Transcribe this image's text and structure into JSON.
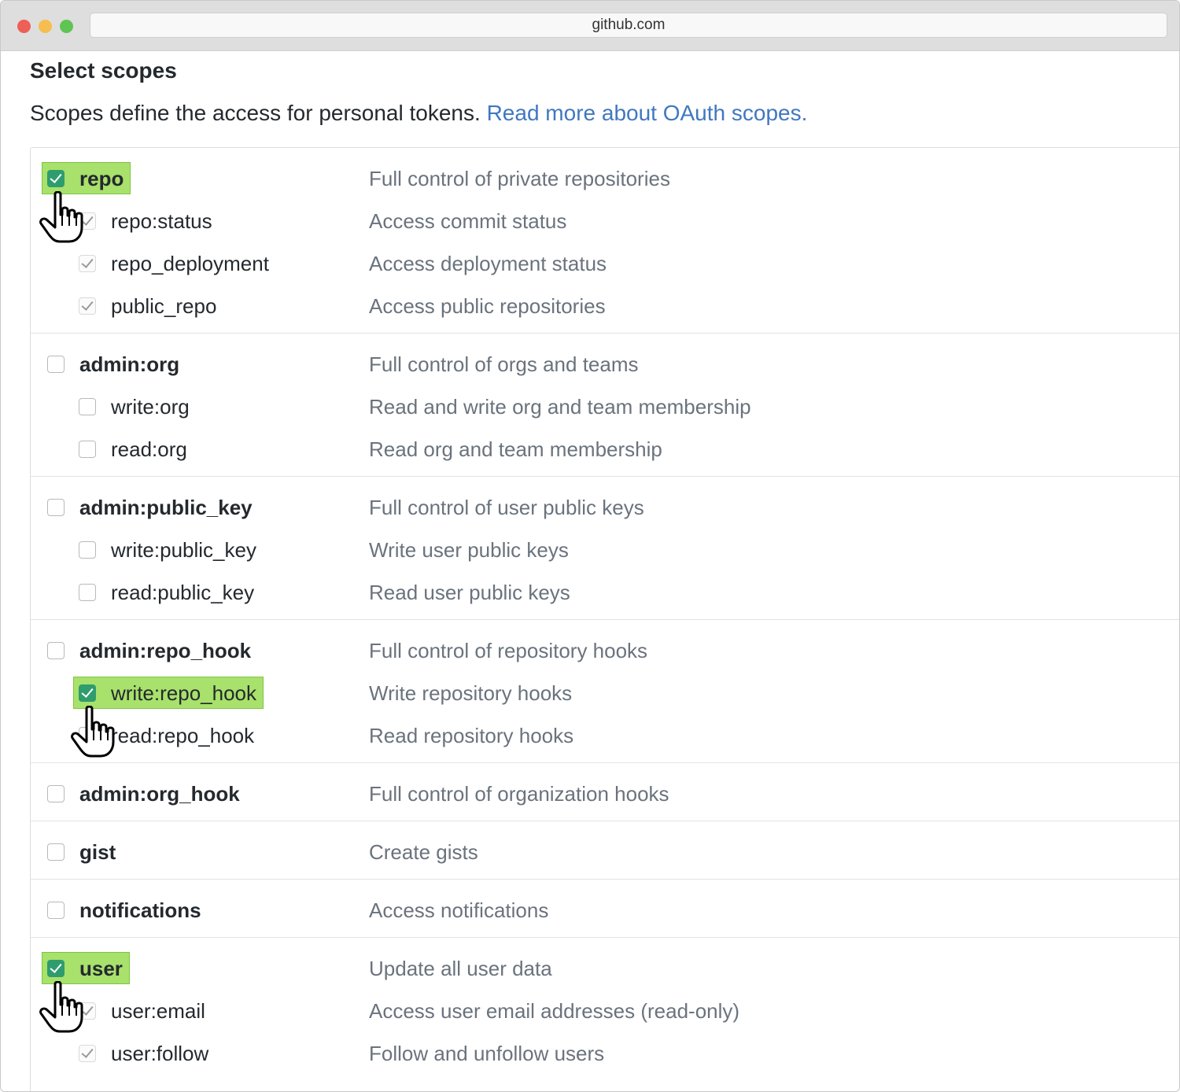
{
  "browser": {
    "url": "github.com"
  },
  "page": {
    "title": "Select scopes",
    "intro": "Scopes define the access for personal tokens.",
    "link": "Read more about OAuth scopes."
  },
  "groups": [
    {
      "name": "repo",
      "description": "Full control of private repositories",
      "state": "checked",
      "children": [
        {
          "name": "repo:status",
          "description": "Access commit status",
          "state": "implied"
        },
        {
          "name": "repo_deployment",
          "description": "Access deployment status",
          "state": "implied"
        },
        {
          "name": "public_repo",
          "description": "Access public repositories",
          "state": "implied"
        }
      ]
    },
    {
      "name": "admin:org",
      "description": "Full control of orgs and teams",
      "state": "unchecked",
      "children": [
        {
          "name": "write:org",
          "description": "Read and write org and team membership",
          "state": "unchecked"
        },
        {
          "name": "read:org",
          "description": "Read org and team membership",
          "state": "unchecked"
        }
      ]
    },
    {
      "name": "admin:public_key",
      "description": "Full control of user public keys",
      "state": "unchecked",
      "children": [
        {
          "name": "write:public_key",
          "description": "Write user public keys",
          "state": "unchecked"
        },
        {
          "name": "read:public_key",
          "description": "Read user public keys",
          "state": "unchecked"
        }
      ]
    },
    {
      "name": "admin:repo_hook",
      "description": "Full control of repository hooks",
      "state": "unchecked",
      "children": [
        {
          "name": "write:repo_hook",
          "description": "Write repository hooks",
          "state": "checked"
        },
        {
          "name": "read:repo_hook",
          "description": "Read repository hooks",
          "state": "unchecked"
        }
      ]
    },
    {
      "name": "admin:org_hook",
      "description": "Full control of organization hooks",
      "state": "unchecked",
      "children": []
    },
    {
      "name": "gist",
      "description": "Create gists",
      "state": "unchecked",
      "children": []
    },
    {
      "name": "notifications",
      "description": "Access notifications",
      "state": "unchecked",
      "children": []
    },
    {
      "name": "user",
      "description": "Update all user data",
      "state": "checked",
      "children": [
        {
          "name": "user:email",
          "description": "Access user email addresses (read-only)",
          "state": "implied"
        },
        {
          "name": "user:follow",
          "description": "Follow and unfollow users",
          "state": "implied"
        }
      ]
    }
  ]
}
